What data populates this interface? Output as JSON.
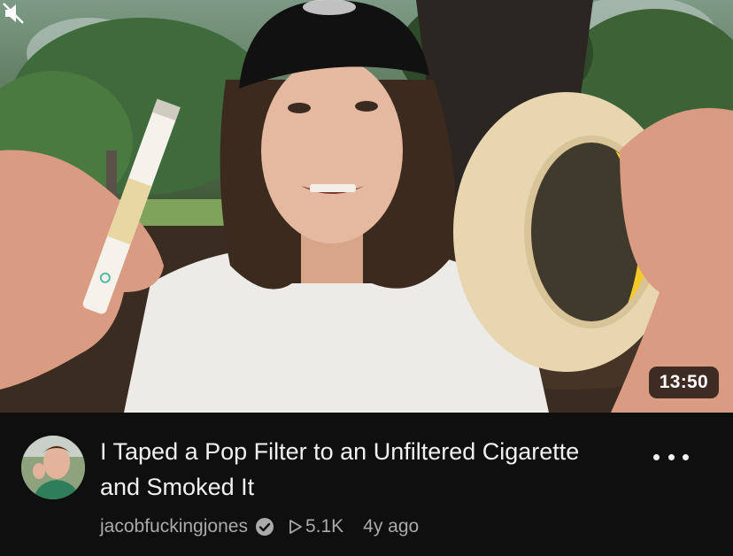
{
  "video": {
    "duration": "13:50",
    "title": "I Taped a Pop Filter to an Unfiltered Cigarette and Smoked It",
    "channel": "jacobfuckingjones",
    "views": "5.1K",
    "age": "4y ago"
  },
  "icons": {
    "verified": "verified-check-icon",
    "views": "play-outline-icon",
    "mute": "mute-icon",
    "more": "more-options-icon"
  },
  "colors": {
    "background": "#0f0f0f",
    "title": "#f1f1f1",
    "secondary": "#aaaaaa"
  }
}
